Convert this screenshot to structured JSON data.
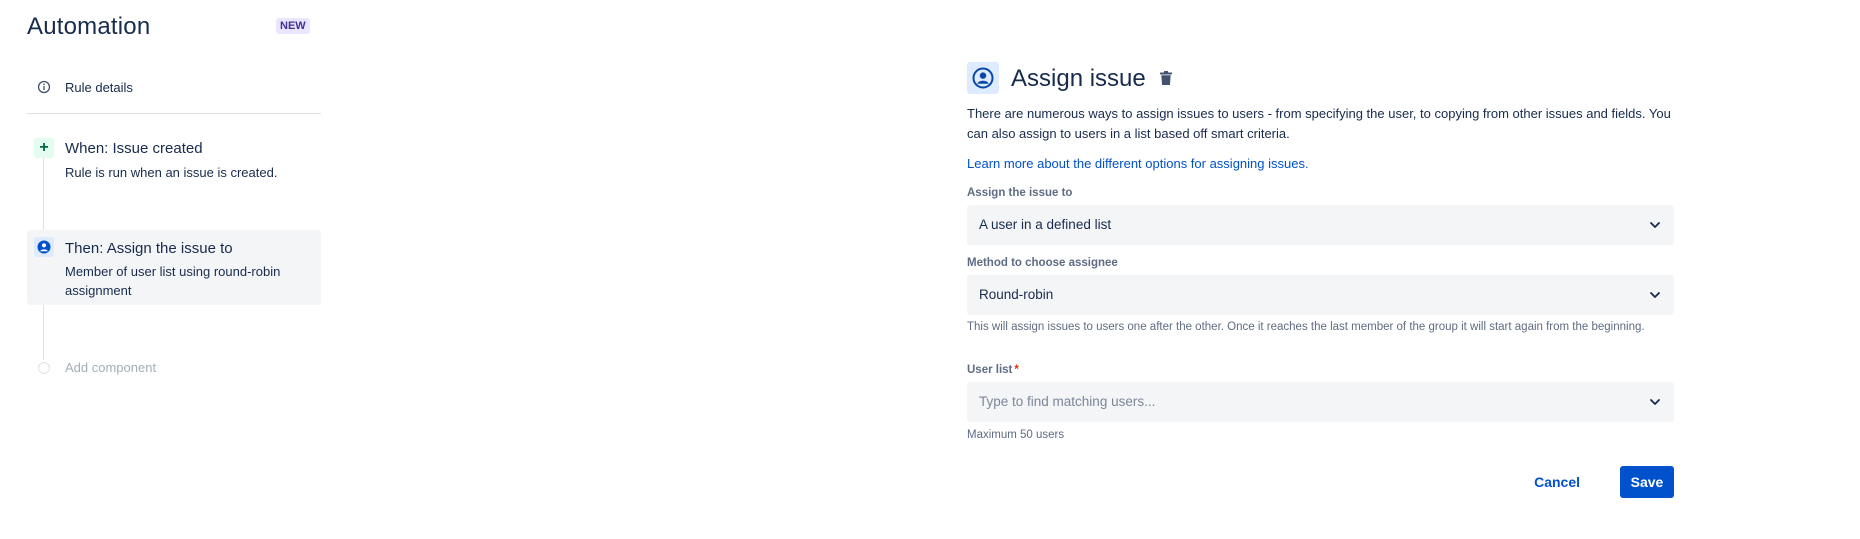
{
  "header": {
    "title": "Automation",
    "badge": "NEW"
  },
  "sidebar": {
    "rule_details": {
      "label": "Rule details",
      "icon": "info-icon"
    },
    "trigger": {
      "icon": "plus-icon",
      "title": "When: Issue created",
      "subtitle": "Rule is run when an issue is created."
    },
    "action": {
      "icon": "user-circle-icon",
      "title": "Then: Assign the issue to",
      "subtitle": "Member of user list using round-robin assignment"
    },
    "add_component": {
      "label": "Add component"
    }
  },
  "panel": {
    "icon": "user-circle-icon",
    "title": "Assign issue",
    "delete_icon": "trash-icon",
    "description": "There are numerous ways to assign issues to users - from specifying the user, to copying from other issues and fields. You can also assign to users in a list based off smart criteria.",
    "learn_more": "Learn more about the different options for assigning issues.",
    "assign_to": {
      "label": "Assign the issue to",
      "value": "A user in a defined list"
    },
    "method": {
      "label": "Method to choose assignee",
      "value": "Round-robin",
      "help": "This will assign issues to users one after the other. Once it reaches the last member of the group it will start again from the beginning."
    },
    "user_list": {
      "label": "User list",
      "required_marker": "*",
      "placeholder": "Type to find matching users...",
      "help": "Maximum 50 users"
    },
    "buttons": {
      "cancel": "Cancel",
      "save": "Save"
    }
  },
  "colors": {
    "primary": "#0052cc",
    "text": "#172b4d",
    "subtle_bg": "#f4f5f7",
    "badge_bg": "#eae6ff",
    "success_bg": "#e3fcef"
  }
}
